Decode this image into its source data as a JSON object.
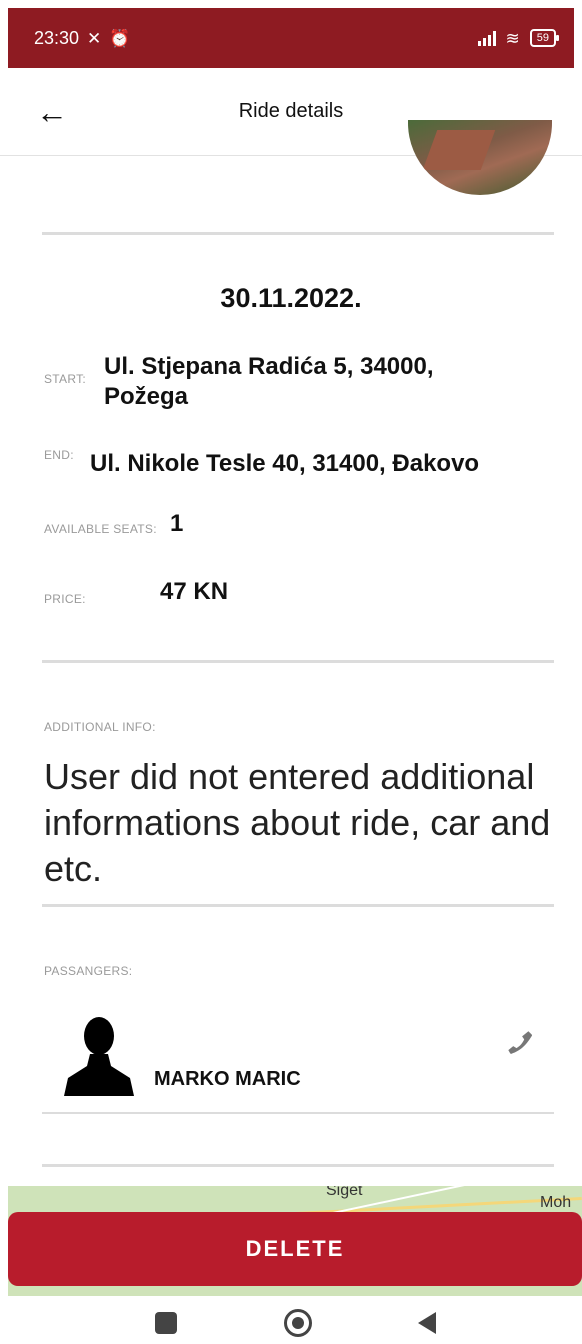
{
  "status_bar": {
    "time": "23:30",
    "battery": "59"
  },
  "app_bar": {
    "title": "Ride details"
  },
  "ride": {
    "date": "30.11.2022.",
    "start_label": "START:",
    "start_value": "Ul. Stjepana Radića 5, 34000, Požega",
    "end_label": "END:",
    "end_value": "Ul. Nikole Tesle 40, 31400, Đakovo",
    "seats_label": "AVAILABLE SEATS:",
    "seats_value": "1",
    "price_label": "PRICE:",
    "price_value": "47 KN"
  },
  "additional": {
    "label": "ADDITIONAL INFO:",
    "text": "User did not entered additional informations about ride, car and etc."
  },
  "passengers": {
    "label": "PASSANGERS:",
    "items": [
      {
        "name": "MARKO MARIC"
      }
    ]
  },
  "map": {
    "labels": [
      "Siget",
      "Moh"
    ]
  },
  "actions": {
    "delete_label": "DELETE"
  },
  "colors": {
    "brand": "#b81c2c",
    "statusbar": "#8e1b22"
  }
}
